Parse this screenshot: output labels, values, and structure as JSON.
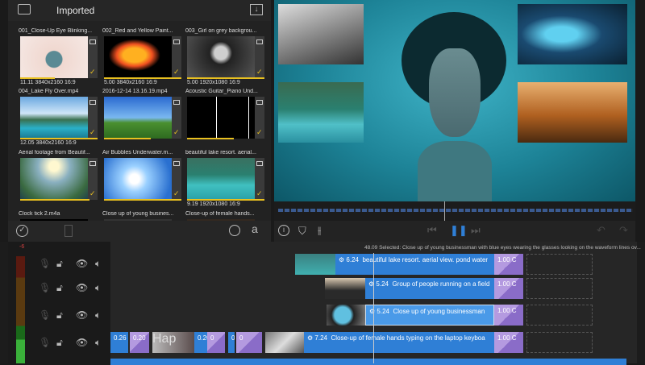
{
  "library": {
    "title": "Imported",
    "clips": [
      {
        "name": "001_Close-Up Eye Blinking...",
        "info": "11.11  3840x2160  16:9",
        "bar": 0.45,
        "bg": "radial-gradient(circle at 50% 55%,#5a8a94 0 10px,#f0d8d0 11px,#f5e8e4 100%)"
      },
      {
        "name": "002_Red and Yellow Paint...",
        "info": "5.00  3840x2160  16:9",
        "bar": 1,
        "bg": "radial-gradient(ellipse at 45% 45%,#ffb020 0 14px,#f05020 22px,#000 32px)"
      },
      {
        "name": "003_Girl on grey backgrou...",
        "info": "5.00  1920x1080  16:9",
        "bar": 1,
        "bg": "radial-gradient(circle at 50% 40%,#cfcfcf 0 8px,#222 14px,#555 100%)"
      },
      {
        "name": "004_Lake Fly Over.mp4",
        "info": "12.05  3840x2160  16:9",
        "bar": 1,
        "bg": "linear-gradient(#6aa8e0,#cfe6f8 40%,#3a7050 55%,#2ab0c8 75%,#1a7890)"
      },
      {
        "name": "2016-12-14 13.16.19.mp4",
        "info": "",
        "bar": 0.6,
        "bg": "linear-gradient(#2a6ad0,#7ab8f0 50%,#4a9030 62%,#2e6a20)"
      },
      {
        "name": "Acoustic Guitar_Piano Und...",
        "info": "",
        "bar": 0.6,
        "bg": "repeating-linear-gradient(90deg,#000 0 36px,#fff 36px 37px,#000 37px 40px)"
      },
      {
        "name": "Aerial footage from Beautif...",
        "info": "",
        "bar": 0.9,
        "bg": "radial-gradient(circle at 50% 20%,#fff8d0 0 6px,#8ab0c0 20px,#3a6a40 45px,#20404a)"
      },
      {
        "name": "Air Bubbles Underwater.m...",
        "info": "",
        "bar": 1,
        "bg": "radial-gradient(circle at 45% 50%,#fff 0 6px,#9ad0ff 16px,#2a70d0 45px)"
      },
      {
        "name": "beautiful lake resort. aerial...",
        "info": "9.19  1920x1080  16:9",
        "bar": 1,
        "bg": "linear-gradient(#3a7060,#2a8070 40%,#40c0c0 65%,#2aa0a8)"
      },
      {
        "name": "Clock tick 2.m4a",
        "info": "",
        "bar": 0,
        "bg": "#000"
      },
      {
        "name": "Close up of young busines...",
        "info": "",
        "bar": 0,
        "bg": "#333"
      },
      {
        "name": "Close-up of female hands...",
        "info": "",
        "bar": 0,
        "bg": "#332820"
      }
    ]
  },
  "timeline": {
    "selected_text": "48.09 Selected: Close up of young businessman with blue eyes wearing the glasses looking on the waveform lines ov...",
    "meter_label": "-6",
    "clips": [
      {
        "dur": "6.24",
        "title": "beautiful lake resort. aerial view. pond water"
      },
      {
        "dur": "5.24",
        "title": "Group of people running on a field"
      },
      {
        "dur": "5.24",
        "title": "Close up of young businessman"
      },
      {
        "dur": "7.24",
        "title": "Close-up of female hands typing on the laptop keyboa"
      }
    ],
    "transition": "1.00  C",
    "small": [
      "0.26",
      "0.20",
      "Hap",
      "0.20",
      "0",
      "0.28",
      "0"
    ]
  },
  "colors": {
    "accent": "#2f7fd6",
    "transition": "#a88ad8",
    "check": "#e8c020"
  }
}
